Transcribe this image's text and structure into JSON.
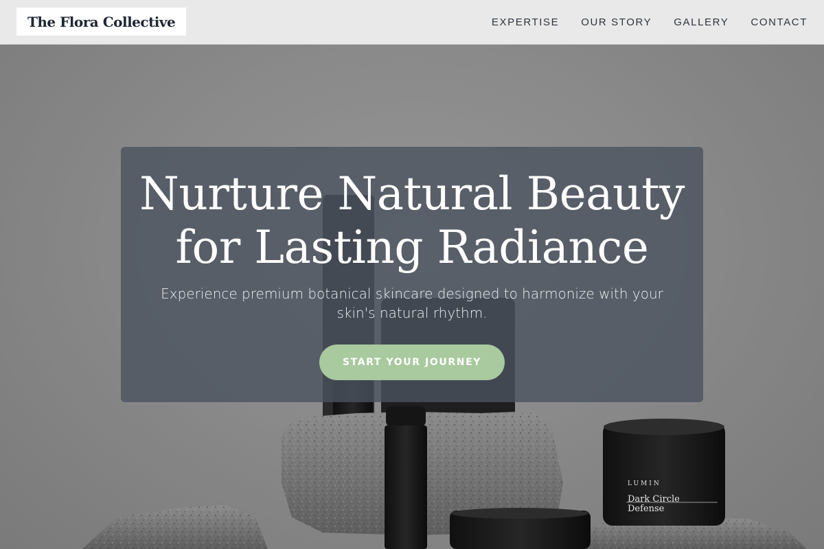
{
  "brand": {
    "name": "The Flora Collective"
  },
  "nav": {
    "items": [
      {
        "label": "EXPERTISE"
      },
      {
        "label": "OUR STORY"
      },
      {
        "label": "GALLERY"
      },
      {
        "label": "CONTACT"
      }
    ]
  },
  "hero": {
    "title_line1": "Nurture Natural Beauty",
    "title_line2": "for Lasting Radiance",
    "subtitle": "Experience premium botanical skincare designed to harmonize with your skin's natural rhythm.",
    "cta_label": "START YOUR JOURNEY"
  },
  "product_labels": {
    "jar_brand": "LUMIN",
    "jar_name_line1": "Dark Circle",
    "jar_name_line2": "Defense"
  },
  "colors": {
    "header_bg": "#e9e9e9",
    "card_overlay": "#4a525f",
    "cta_bg": "#a9c99f",
    "text_dark": "#1f2633"
  }
}
